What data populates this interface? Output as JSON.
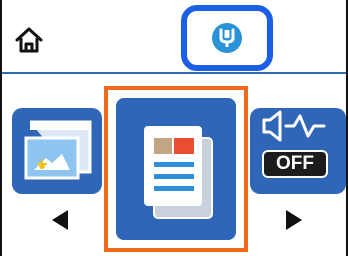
{
  "header": {
    "home_icon": "home-icon",
    "wifi_icon": "wifi-direct-icon"
  },
  "colors": {
    "tile_blue": "#2f66b8",
    "focus_orange": "#f06a1b",
    "highlight_blue": "#1b5fe6",
    "status_blue": "#2a92d6"
  },
  "carousel": {
    "left_item": {
      "icon": "scan-icon"
    },
    "center_item": {
      "icon": "copy-document-icon",
      "selected": true
    },
    "right_item": {
      "icon": "sound-icon",
      "state_label": "OFF"
    },
    "prev_icon": "left-arrow-icon",
    "next_icon": "right-arrow-icon"
  }
}
